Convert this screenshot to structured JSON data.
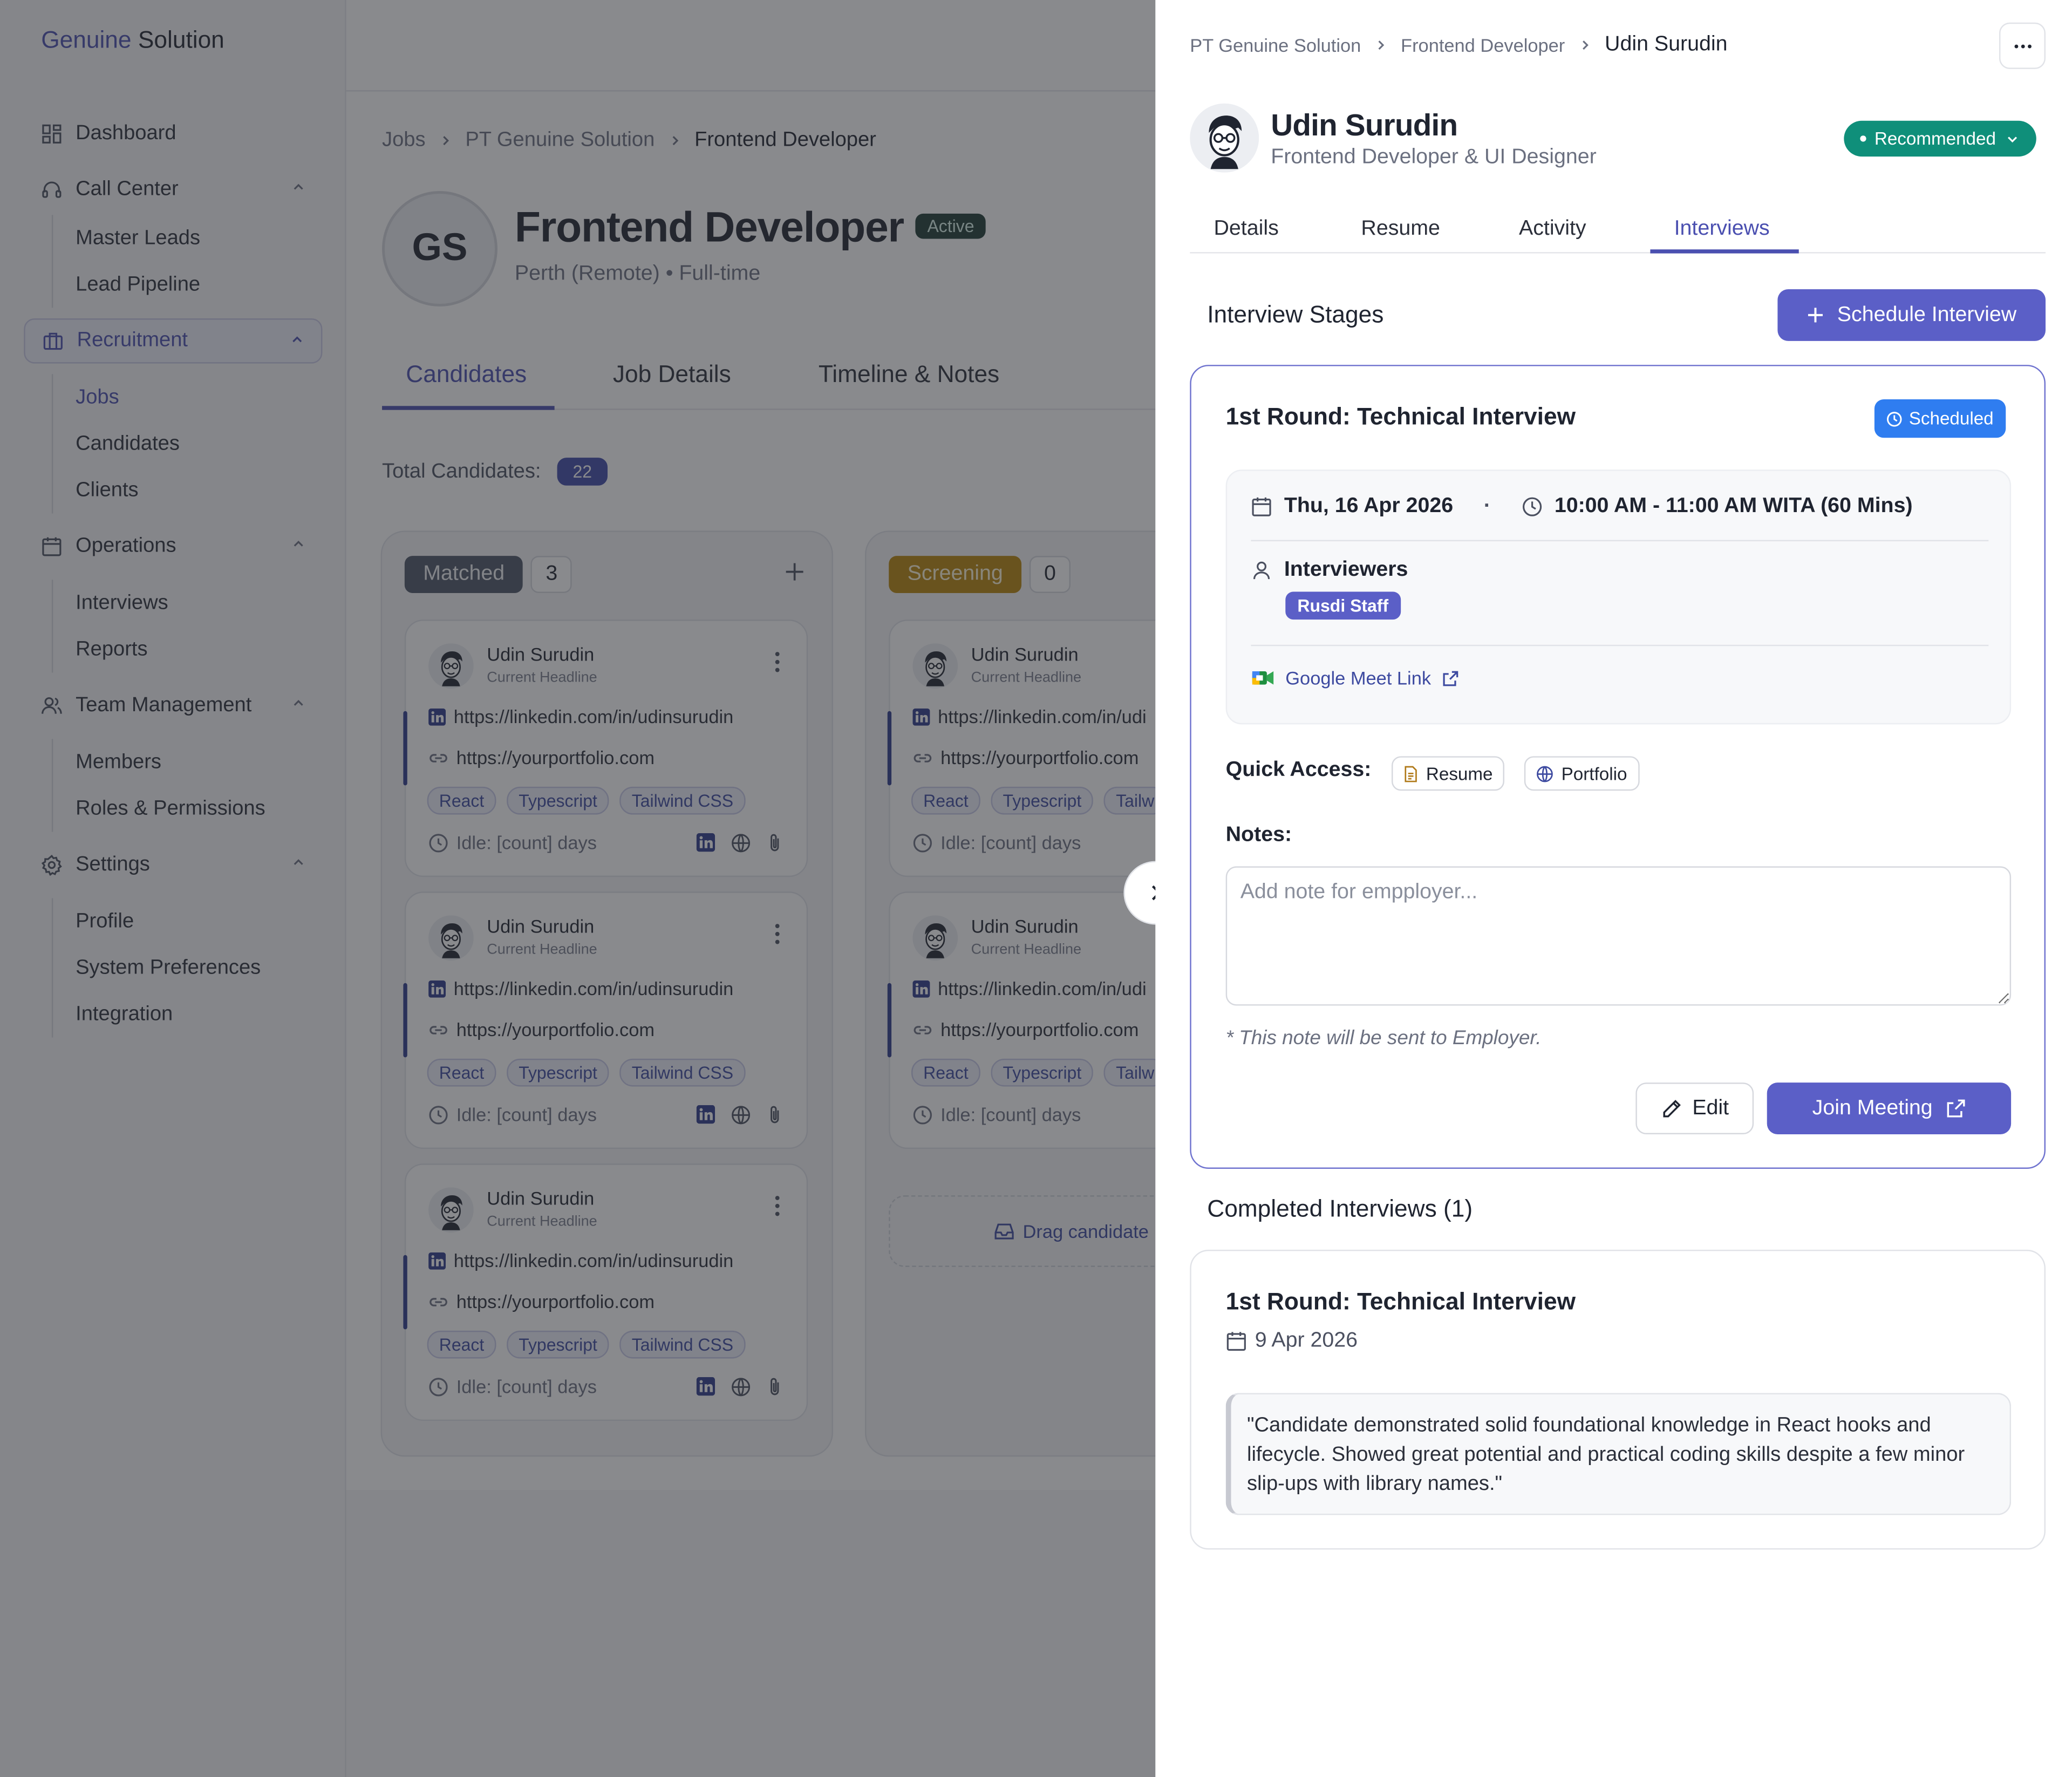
{
  "brand": {
    "part1": "Genuine",
    "part2": "Solution"
  },
  "sidebar": {
    "dashboard": "Dashboard",
    "call_center": "Call Center",
    "call_center_items": [
      "Master Leads",
      "Lead Pipeline"
    ],
    "recruitment": "Recruitment",
    "recruitment_items": [
      "Jobs",
      "Candidates",
      "Clients"
    ],
    "operations": "Operations",
    "operations_items": [
      "Interviews",
      "Reports"
    ],
    "team_management": "Team Management",
    "team_items": [
      "Members",
      "Roles & Permissions"
    ],
    "settings": "Settings",
    "settings_items": [
      "Profile",
      "System Preferences",
      "Integration"
    ]
  },
  "job": {
    "breadcrumb": [
      "Jobs",
      "PT Genuine Solution",
      "Frontend Developer"
    ],
    "initials": "GS",
    "title": "Frontend Developer",
    "status": "Active",
    "subtitle": "Perth (Remote) • Full-time",
    "tabs": [
      "Candidates",
      "Job Details",
      "Timeline & Notes"
    ],
    "total_label": "Total Candidates:",
    "total_count": "22"
  },
  "board": {
    "columns": [
      {
        "name": "Matched",
        "count": "3"
      },
      {
        "name": "Screening",
        "count": "0"
      }
    ],
    "card": {
      "name": "Udin Surudin",
      "headline": "Current Headline",
      "linkedin": "https://linkedin.com/in/udinsurudin",
      "linkedin_cut": "https://linkedin.com/in/udi",
      "portfolio": "https://yourportfolio.com",
      "tags": [
        "React",
        "Typescript",
        "Tailwind CSS"
      ],
      "tag_cut": "Tailw",
      "idle": "Idle: [count] days"
    },
    "dropzone": "Drag candidate"
  },
  "drawer": {
    "breadcrumb": [
      "PT Genuine Solution",
      "Frontend Developer",
      "Udin Surudin"
    ],
    "more": "···",
    "name": "Udin Surudin",
    "role": "Frontend Developer & UI Designer",
    "status": "Recommended",
    "tabs": [
      "Details",
      "Resume",
      "Activity",
      "Interviews"
    ],
    "stages_title": "Interview Stages",
    "schedule_button": "Schedule Interview",
    "stage": {
      "title": "1st Round: Technical Interview",
      "status": "Scheduled",
      "date": "Thu, 16 Apr 2026",
      "time": "10:00 AM - 11:00 AM WITA (60 Mins)",
      "interviewers_label": "Interviewers",
      "interviewer": "Rusdi Staff",
      "meet_link": "Google Meet Link",
      "quick_access_label": "Quick Access:",
      "quick_access": [
        "Resume",
        "Portfolio"
      ],
      "notes_label": "Notes:",
      "notes_placeholder": "Add note for empployer...",
      "notes_hint": "* This note will be sent to Employer.",
      "edit_button": "Edit",
      "join_button": "Join Meeting"
    },
    "completed_title": "Completed Interviews (1)",
    "completed": {
      "title": "1st Round: Technical Interview",
      "date": "9 Apr 2026",
      "note": "\"Candidate demonstrated solid foundational knowledge in React hooks and lifecycle. Showed great potential and practical coding skills despite a few minor slip-ups with library names.\""
    }
  },
  "colors": {
    "accent": "#5b5fc7",
    "recommended": "#0f8f7a",
    "scheduled": "#2f7df0",
    "matched": "#4d5566",
    "screening": "#b8860b"
  }
}
